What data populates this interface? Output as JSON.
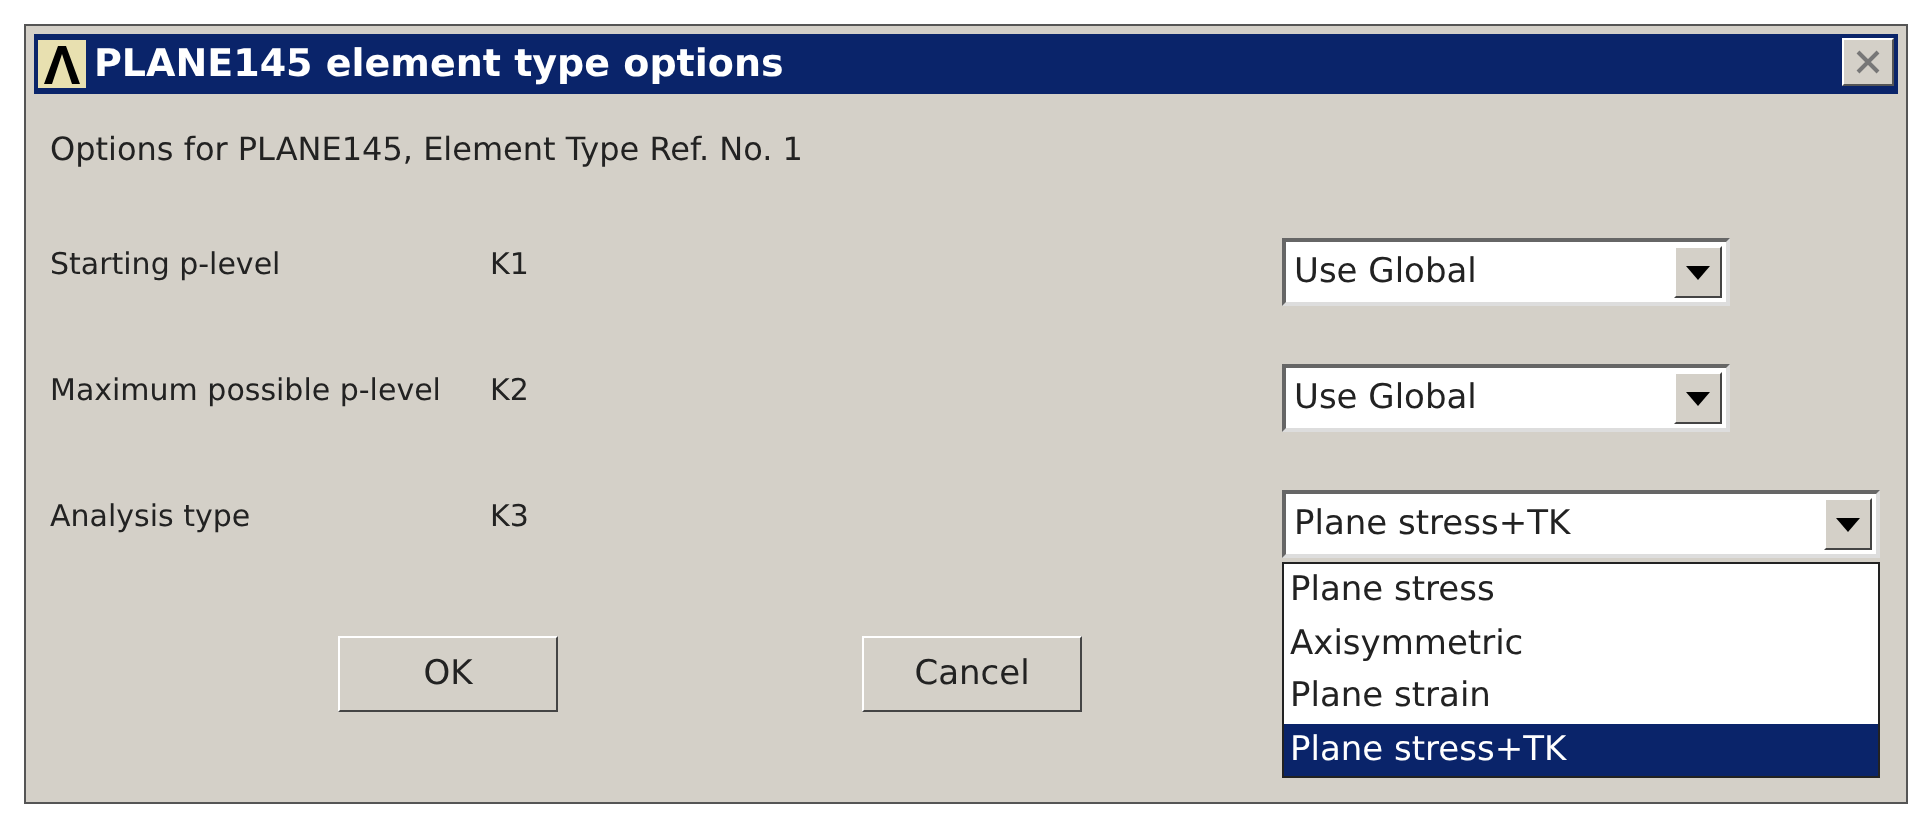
{
  "window": {
    "title": "PLANE145 element type options"
  },
  "header": "Options for PLANE145, Element Type Ref. No. 1",
  "options": [
    {
      "label": "Starting p-level",
      "key": "K1",
      "value": "Use Global"
    },
    {
      "label": "Maximum possible p-level",
      "key": "K2",
      "value": "Use Global"
    },
    {
      "label": "Analysis type",
      "key": "K3",
      "value": "Plane stress+TK",
      "expanded": true,
      "items": [
        {
          "label": "Plane stress",
          "selected": false
        },
        {
          "label": "Axisymmetric",
          "selected": false
        },
        {
          "label": "Plane strain",
          "selected": false
        },
        {
          "label": "Plane stress+TK",
          "selected": true
        }
      ]
    }
  ],
  "buttons": [
    "OK",
    "Cancel"
  ]
}
